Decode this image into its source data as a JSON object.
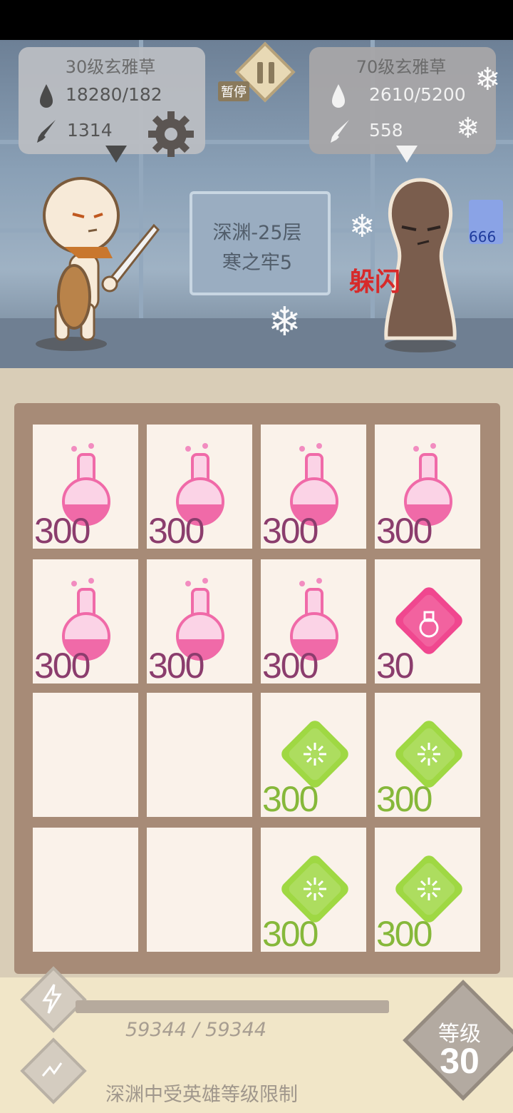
{
  "hud": {
    "pause_label": "暂停",
    "player": {
      "level_name": "30级玄雅草",
      "hp": "18280/182",
      "attack": "1314"
    },
    "enemy": {
      "level_name": "70级玄雅草",
      "hp": "2610/5200",
      "attack": "558"
    }
  },
  "stage": {
    "line1": "深渊-25层",
    "line2": "寒之牢5"
  },
  "battle": {
    "status_text": "躲闪",
    "buff_value": "666"
  },
  "grid": {
    "cells": [
      {
        "item": "potion",
        "count": "300"
      },
      {
        "item": "potion",
        "count": "300"
      },
      {
        "item": "potion",
        "count": "300"
      },
      {
        "item": "potion",
        "count": "300"
      },
      {
        "item": "potion",
        "count": "300"
      },
      {
        "item": "potion",
        "count": "300"
      },
      {
        "item": "potion",
        "count": "300"
      },
      {
        "item": "pink-gem",
        "count": "30"
      },
      {
        "item": "empty",
        "count": ""
      },
      {
        "item": "empty",
        "count": ""
      },
      {
        "item": "green-gem",
        "count": "300"
      },
      {
        "item": "green-gem",
        "count": "300"
      },
      {
        "item": "empty",
        "count": ""
      },
      {
        "item": "empty",
        "count": ""
      },
      {
        "item": "green-gem",
        "count": "300"
      },
      {
        "item": "green-gem",
        "count": "300"
      }
    ]
  },
  "footer": {
    "xp_text": "59344 / 59344",
    "xp_fraction": 1.0,
    "level_label": "等级",
    "level_value": "30",
    "hint": "深渊中受英雄等级限制"
  },
  "colors": {
    "potion": "#f06aa8",
    "pink_gem": "#ef3d8a",
    "green_gem": "#9ad63a",
    "board": "#a78b77"
  }
}
